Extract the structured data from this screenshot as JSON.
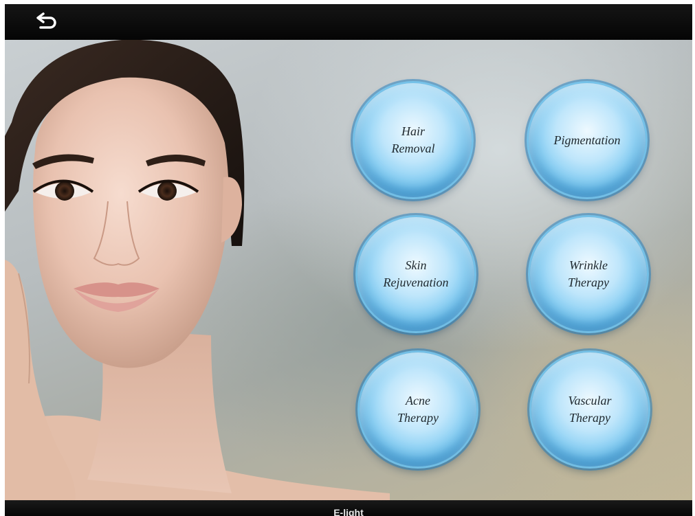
{
  "app": {
    "back_icon": "back-arrow-icon",
    "bottom_title": "E-light"
  },
  "menu": {
    "items": [
      {
        "label": "Hair\nRemoval",
        "icon": "treatment-bubble"
      },
      {
        "label": "Pigmentation",
        "icon": "treatment-bubble"
      },
      {
        "label": "Skin\nRejuvenation",
        "icon": "treatment-bubble"
      },
      {
        "label": "Wrinkle\nTherapy",
        "icon": "treatment-bubble"
      },
      {
        "label": "Acne\nTherapy",
        "icon": "treatment-bubble"
      },
      {
        "label": "Vascular\nTherapy",
        "icon": "treatment-bubble"
      }
    ]
  },
  "colors": {
    "bar": "#0a0a0a",
    "bubble_accent": "#43a9e2",
    "label_text": "#202a30"
  }
}
